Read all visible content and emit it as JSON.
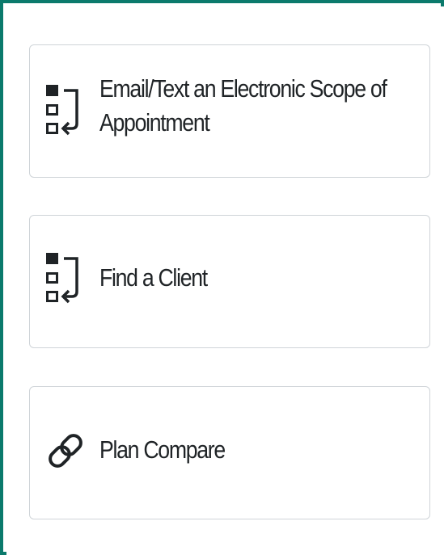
{
  "actions": [
    {
      "label": "Email/Text an Electronic Scope of Appointment",
      "icon": "flow-list-icon"
    },
    {
      "label": "Find a Client",
      "icon": "flow-list-icon"
    },
    {
      "label": "Plan Compare",
      "icon": "link-icon"
    }
  ],
  "colors": {
    "frame_border": "#0b7a6c",
    "card_border": "#cfd4d8",
    "text": "#1f2326",
    "icon": "#1f2326"
  }
}
